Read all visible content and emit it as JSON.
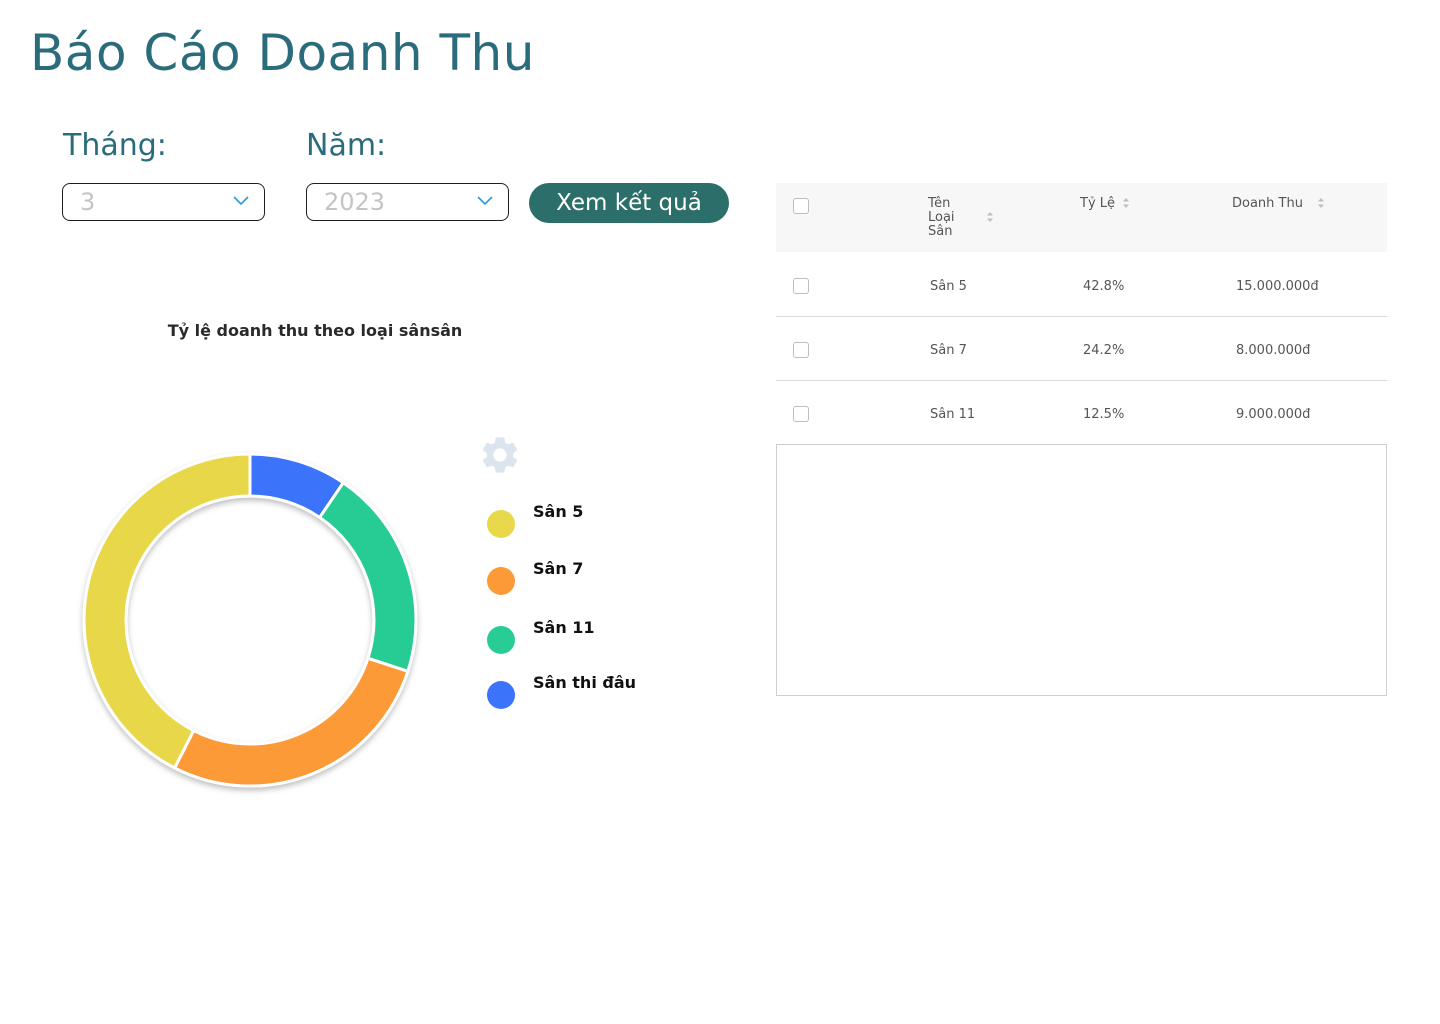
{
  "page": {
    "title": "Báo Cáo Doanh Thu"
  },
  "filters": {
    "month_label": "Tháng:",
    "month_value": "3",
    "year_label": "Năm:",
    "year_value": "2023",
    "submit_label": "Xem kết quả"
  },
  "chart": {
    "title": "Tỷ lệ doanh thu theo loại sânsân",
    "legend": [
      {
        "label": "Sân 5",
        "color": "#e8d84a"
      },
      {
        "label": "Sân 7",
        "color": "#fd9a38"
      },
      {
        "label": "Sân 11",
        "color": "#28cc94"
      },
      {
        "label": "Sân thi đâu",
        "color": "#3b73fb"
      }
    ]
  },
  "chart_data": {
    "type": "pie",
    "title": "Tỷ lệ doanh thu theo loại sânsân",
    "categories": [
      "Sân 5",
      "Sân 7",
      "Sân 11",
      "Sân thi đâu"
    ],
    "values": [
      42.5,
      27.5,
      20.5,
      9.5
    ],
    "colors": [
      "#e8d84a",
      "#fd9a38",
      "#28cc94",
      "#3b73fb"
    ],
    "legend_position": "right",
    "donut": true
  },
  "table": {
    "columns": [
      "Tên Loại Sân",
      "Tỷ Lệ",
      "Doanh Thu"
    ],
    "rows": [
      {
        "name": "Sân 5",
        "ratio": "42.8%",
        "revenue": "15.000.000đ"
      },
      {
        "name": "Sân 7",
        "ratio": "24.2%",
        "revenue": "8.000.000đ"
      },
      {
        "name": "Sân 11",
        "ratio": "12.5%",
        "revenue": "9.000.000đ"
      }
    ]
  },
  "icons": {
    "settings": "gear-icon",
    "dropdown": "chevron-down-icon",
    "sort": "sort-icon"
  },
  "colors": {
    "title": "#2b6c7c",
    "button": "#2b6e6a",
    "gear": "#dce4ee"
  }
}
